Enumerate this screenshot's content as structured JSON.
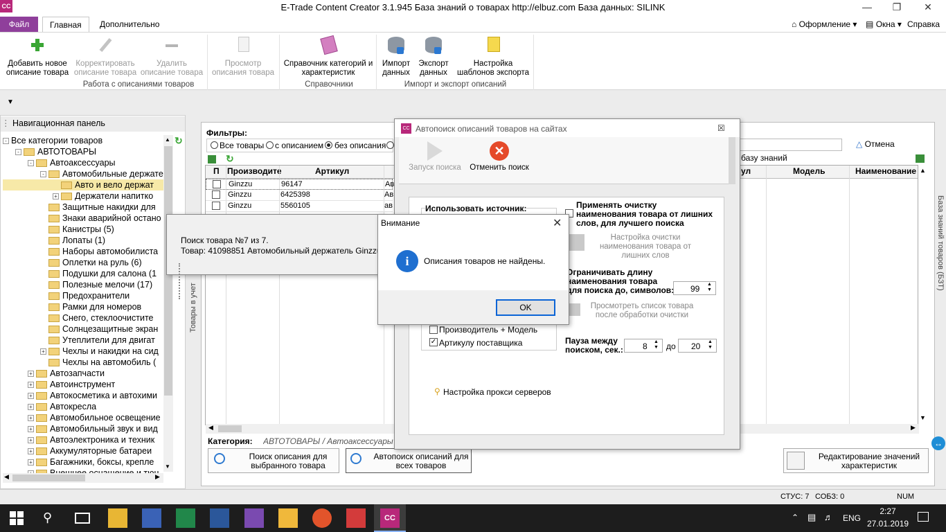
{
  "window": {
    "title": "E-Trade Content Creator 3.1.945     База знаний о товарах    http://elbuz.com     База данных: SILINK",
    "app_icon": "CC"
  },
  "ribbon_tabs": {
    "file": "Файл",
    "main": "Главная",
    "extra": "Дополнительно"
  },
  "ribbon_menus": {
    "design": "Оформление",
    "windows": "Окна",
    "help": "Справка"
  },
  "ribbon": {
    "add": "Добавить новое описание товара",
    "edit": "Корректировать описание товара",
    "delete": "Удалить описание товара",
    "view": "Просмотр описания товара",
    "catalog": "Справочник категорий и характеристик",
    "import": "Импорт данных",
    "export": "Экспорт данных",
    "templates": "Настройка шаблонов экспорта",
    "group_work": "Работа с описаниями товаров",
    "group_refs": "Справочники",
    "group_io": "Импорт и экспорт описаний"
  },
  "nav": {
    "title": "Навигационная панель",
    "tree": [
      {
        "level": 0,
        "box": "-",
        "label": "Все категории товаров",
        "folder": false
      },
      {
        "level": 1,
        "box": "-",
        "label": "АВТОТОВАРЫ",
        "folder": true
      },
      {
        "level": 2,
        "box": "-",
        "label": "Автоаксессуары",
        "folder": true
      },
      {
        "level": 3,
        "box": "-",
        "label": "Автомобильные держате",
        "folder": true
      },
      {
        "level": 4,
        "box": "",
        "label": "Авто и вело держат",
        "folder": true,
        "selected": true
      },
      {
        "level": 4,
        "box": "+",
        "label": "Держатели напитко",
        "folder": true
      },
      {
        "level": 3,
        "box": "",
        "label": "Защитные накидки для",
        "folder": true
      },
      {
        "level": 3,
        "box": "",
        "label": "Знаки аварийной остано",
        "folder": true
      },
      {
        "level": 3,
        "box": "",
        "label": "Канистры (5)",
        "folder": true
      },
      {
        "level": 3,
        "box": "",
        "label": "Лопаты (1)",
        "folder": true
      },
      {
        "level": 3,
        "box": "",
        "label": "Наборы автомобилиста",
        "folder": true
      },
      {
        "level": 3,
        "box": "",
        "label": "Оплетки на руль (6)",
        "folder": true
      },
      {
        "level": 3,
        "box": "",
        "label": "Подушки для салона (1",
        "folder": true
      },
      {
        "level": 3,
        "box": "",
        "label": "Полезные мелочи (17)",
        "folder": true
      },
      {
        "level": 3,
        "box": "",
        "label": "Предохранители",
        "folder": true
      },
      {
        "level": 3,
        "box": "",
        "label": "Рамки для номеров",
        "folder": true
      },
      {
        "level": 3,
        "box": "",
        "label": "Снего, стеклоочистите",
        "folder": true
      },
      {
        "level": 3,
        "box": "",
        "label": "Солнцезащитные экран",
        "folder": true
      },
      {
        "level": 3,
        "box": "",
        "label": "Утеплители для двигат",
        "folder": true
      },
      {
        "level": 3,
        "box": "+",
        "label": "Чехлы и накидки на сид",
        "folder": true
      },
      {
        "level": 3,
        "box": "",
        "label": "Чехлы на автомобиль (",
        "folder": true
      },
      {
        "level": 2,
        "box": "+",
        "label": "Автозапчасти",
        "folder": true
      },
      {
        "level": 2,
        "box": "+",
        "label": "Автоинструмент",
        "folder": true
      },
      {
        "level": 2,
        "box": "+",
        "label": "Автокосметика и автохими",
        "folder": true
      },
      {
        "level": 2,
        "box": "+",
        "label": "Автокресла",
        "folder": true
      },
      {
        "level": 2,
        "box": "+",
        "label": "Автомобильное освещение",
        "folder": true
      },
      {
        "level": 2,
        "box": "+",
        "label": "Автомобильный звук и вид",
        "folder": true
      },
      {
        "level": 2,
        "box": "+",
        "label": "Автоэлектроника и техник",
        "folder": true
      },
      {
        "level": 2,
        "box": "+",
        "label": "Аккумуляторные батареи",
        "folder": true
      },
      {
        "level": 2,
        "box": "+",
        "label": "Багажники, боксы, крепле",
        "folder": true
      },
      {
        "level": 2,
        "box": "+",
        "label": "Внешнее оснащение и тюн",
        "folder": true
      }
    ]
  },
  "main": {
    "filters_label": "Фильтры:",
    "filter_all": "Все товары",
    "filter_with": "с описанием",
    "filter_without": "без описания",
    "cancel": "Отмена",
    "kb_label": "базу знаний",
    "side_vertical_left": "Товары в учет",
    "side_vertical_right": "База знаний товаров (БЗТ)",
    "columns_left": [
      "П",
      "Производите",
      "Артикул"
    ],
    "columns_right": [
      "ул",
      "Модель",
      "Наименование"
    ],
    "rows": [
      {
        "maker": "Ginzzu",
        "article": "96147",
        "rest": "Ав"
      },
      {
        "maker": "Ginzzu",
        "article": "6425398",
        "rest": "Ав"
      },
      {
        "maker": "Ginzzu",
        "article": "5560105",
        "rest": "ав"
      }
    ],
    "category_label": "Категория:",
    "category_path": "АВТОТОВАРЫ / Автоаксессуары / Ав",
    "btn_search_one": "Поиск описания для выбранного товара",
    "btn_search_all": "Автопоиск описаний для всех товаров",
    "btn_edit_values": "Редактирование значений характеристик"
  },
  "autosearch_dialog": {
    "title": "Автопоиск описаний товаров на сайтах",
    "start": "Запуск поиска",
    "cancel": "Отменить поиск",
    "use_source": "Использовать источник:",
    "opt_maker_model": "Производитель + Модель",
    "opt_supplier_article": "Артикулу поставщика",
    "clean_names": "Применять очистку наименования товара от лишних слов, для лучшего поиска",
    "clean_settings": "Настройка очистки наименования товара от лишних слов",
    "limit_length": "Ограничивать длину наименования товара для поиска до, символов:",
    "limit_value": "99",
    "view_list": "Просмотреть список товара после обработки очистки",
    "pause_label": "Пауза между поиском, сек.:",
    "pause_from": "8",
    "pause_to_label": "до",
    "pause_to": "20",
    "proxy": "Настройка прокси серверов"
  },
  "progress_popup": {
    "line1": "Поиск товара №7 из 7.",
    "line2": "Товар: 41098851 Автомобильный держатель Ginzzu"
  },
  "alert": {
    "title": "Внимание",
    "message": "Описания товаров не найдены.",
    "ok": "OK"
  },
  "status": {
    "stus": "СТУС: 7",
    "sobz": "СОБЗ: 0",
    "num": "NUM"
  },
  "taskbar": {
    "lang": "ENG",
    "time": "2:27",
    "date": "27.01.2019"
  }
}
